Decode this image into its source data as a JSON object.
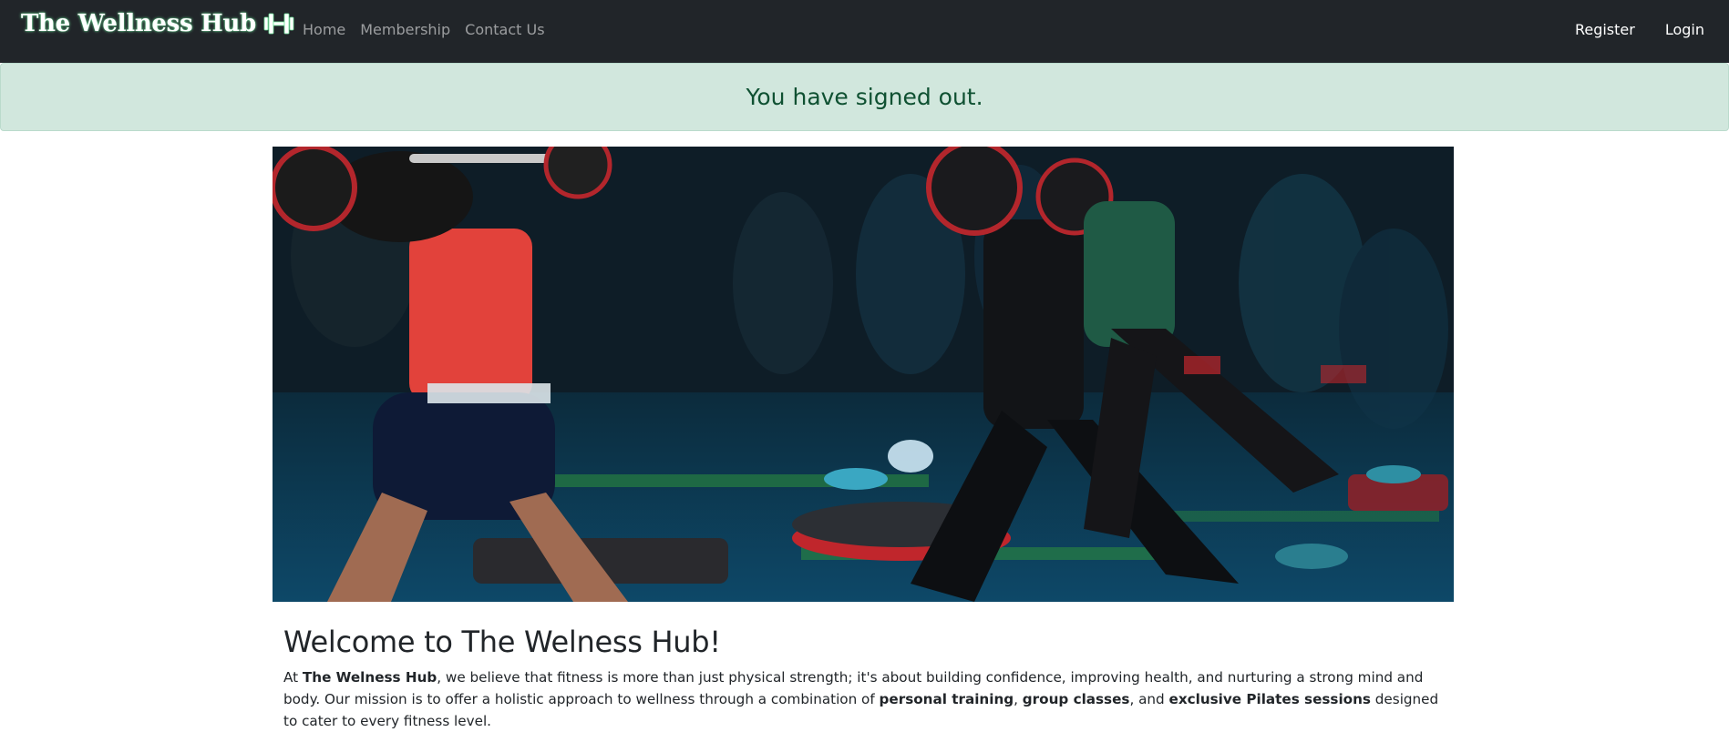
{
  "navbar": {
    "brand": "The Wellness Hub",
    "brand_icon": "dumbbell-icon",
    "links": [
      "Home",
      "Membership",
      "Contact Us"
    ],
    "auth_links": [
      "Register",
      "Login"
    ],
    "brand_glow_color": "#6fe39a",
    "background": "#212529"
  },
  "alert": {
    "message": "You have signed out.",
    "background": "#d1e7dd",
    "text_color": "#0f5132"
  },
  "hero": {
    "image": "group-fitness-class-photo"
  },
  "welcome": {
    "title": "Welcome to The Welness Hub!",
    "intro": {
      "p1": "At ",
      "b1": "The Welness Hub",
      "p2": ", we believe that fitness is more than just physical strength; it's about building confidence, improving health, and nurturing a strong mind and body. Our mission is to offer a holistic approach to wellness through a combination of ",
      "b2": "personal training",
      "p3": ", ",
      "b3": "group classes",
      "p4": ", and ",
      "b4": "exclusive Pilates sessions",
      "p5": " designed to cater to every fitness level."
    }
  }
}
